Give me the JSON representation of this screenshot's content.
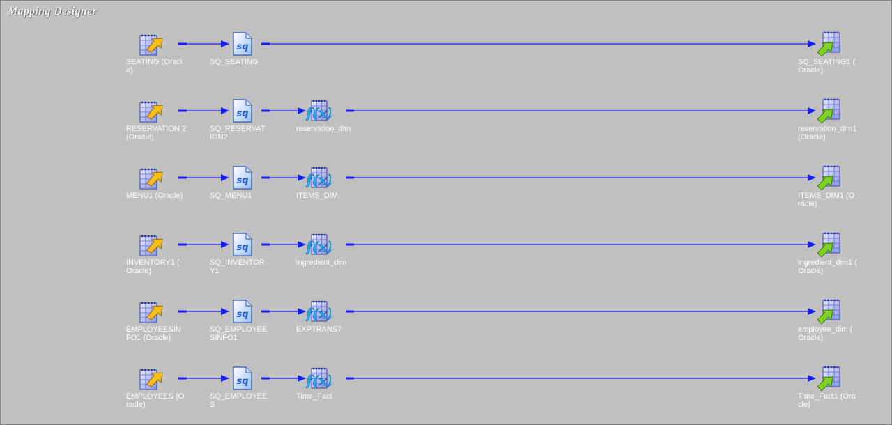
{
  "title": "Mapping Designer",
  "colors": {
    "canvas": "#c0c0c0",
    "link": "#1a1aff",
    "label": "#ffffff"
  },
  "icons": {
    "source": "source-icon",
    "qualifier": "source-qualifier-icon",
    "expression": "expression-icon",
    "target": "target-icon"
  },
  "rows": [
    {
      "source": "SEATING (Oracl\ne)",
      "qualifier": "SQ_SEATING",
      "expression": "",
      "target": "SQ_SEATING1 (\nOracle)"
    },
    {
      "source": "RESERVATION 2\n(Oracle)",
      "qualifier": "SQ_RESERVAT\nION2",
      "expression": "reservation_dim",
      "target": "reservation_dim1\n(Oracle)"
    },
    {
      "source": "MENU1 (Oracle)",
      "qualifier": "SQ_MENU1",
      "expression": "ITEMS_DIM",
      "target": "ITEMS_DIM1 (O\nracle)"
    },
    {
      "source": "INVENTORY1 (\nOracle)",
      "qualifier": "SQ_INVENTOR\nY1",
      "expression": "ingredient_dim",
      "target": "ingredient_dim1 (\nOracle)"
    },
    {
      "source": "EMPLOYEESIN\nFO1 (Oracle)",
      "qualifier": "SQ_EMPLOYEE\nSINFO1",
      "expression": "EXPTRANS7",
      "target": "employee_dim (\nOracle)"
    },
    {
      "source": "EMPLOYEES (O\nracle)",
      "qualifier": "SQ_EMPLOYEE\nS",
      "expression": "Time_Fact",
      "target": "Time_Fact1 (Ora\ncle)"
    }
  ]
}
